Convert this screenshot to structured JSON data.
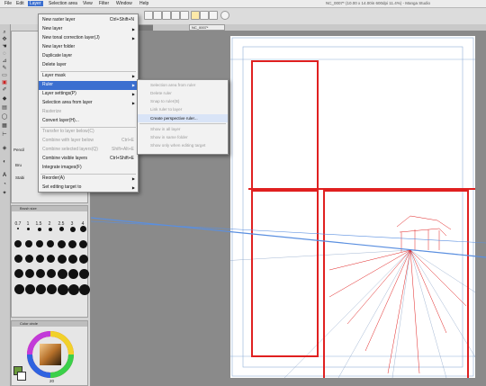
{
  "menubar": {
    "items": [
      "File",
      "Edit",
      "Layer",
      "Selection area",
      "View",
      "Filter",
      "Window",
      "Help"
    ],
    "active": "Layer"
  },
  "window": {
    "title": "NC_0007* (10.00 x 14.00in 600dpi 11.4%) - Manga Studio"
  },
  "tab": {
    "label": "NC_0007*"
  },
  "layer_menu": {
    "items": [
      {
        "label": "New raster layer",
        "shortcut": "Ctrl+Shift+N",
        "enabled": true,
        "arrow": false
      },
      {
        "label": "New layer",
        "shortcut": "",
        "enabled": true,
        "arrow": true
      },
      {
        "label": "New tonal correction layer(J)",
        "shortcut": "",
        "enabled": true,
        "arrow": true
      },
      {
        "label": "New layer folder",
        "shortcut": "",
        "enabled": true,
        "arrow": false
      },
      {
        "label": "Duplicate layer",
        "shortcut": "",
        "enabled": true,
        "arrow": false
      },
      {
        "label": "Delete layer",
        "shortcut": "",
        "enabled": true,
        "arrow": false
      },
      {
        "label": "Layer mask",
        "shortcut": "",
        "enabled": true,
        "arrow": true
      },
      {
        "label": "Ruler",
        "shortcut": "",
        "enabled": true,
        "arrow": true,
        "highlight": true
      },
      {
        "label": "Layer settings(P)",
        "shortcut": "",
        "enabled": true,
        "arrow": true
      },
      {
        "label": "Selection area from layer",
        "shortcut": "",
        "enabled": true,
        "arrow": true
      },
      {
        "label": "Rasterize",
        "shortcut": "",
        "enabled": false,
        "arrow": false
      },
      {
        "label": "Convert layer(H)...",
        "shortcut": "",
        "enabled": true,
        "arrow": false
      },
      {
        "label": "Transfer to layer below(C)",
        "shortcut": "",
        "enabled": false,
        "arrow": false
      },
      {
        "label": "Combine with layer below",
        "shortcut": "Ctrl+E",
        "enabled": false,
        "arrow": false
      },
      {
        "label": "Combine selected layers(Q)",
        "shortcut": "Shift+Alt+E",
        "enabled": false,
        "arrow": false
      },
      {
        "label": "Combine visible layers",
        "shortcut": "Ctrl+Shift+E",
        "enabled": true,
        "arrow": false
      },
      {
        "label": "Integrate images(F)",
        "shortcut": "",
        "enabled": true,
        "arrow": false
      },
      {
        "label": "Reorder(A)",
        "shortcut": "",
        "enabled": true,
        "arrow": true
      },
      {
        "label": "Set editing target to",
        "shortcut": "",
        "enabled": true,
        "arrow": true
      }
    ]
  },
  "ruler_submenu": {
    "items": [
      {
        "label": "Selection area from ruler",
        "enabled": false
      },
      {
        "label": "Delete ruler",
        "enabled": false
      },
      {
        "label": "Snap to ruler(B)",
        "enabled": false
      },
      {
        "label": "Link ruler to layer",
        "enabled": false
      },
      {
        "label": "Create perspective ruler...",
        "enabled": true,
        "highlight": true
      },
      {
        "label": "Show in all layer",
        "enabled": false
      },
      {
        "label": "Show in same folder",
        "enabled": false
      },
      {
        "label": "Show only when editing target",
        "enabled": false
      }
    ]
  },
  "left_panel": {
    "tool_tabs": [
      "Pencil",
      "Bru",
      "Stabi"
    ],
    "brush_size_title": "Brush size",
    "brush_sizes": [
      "0.7",
      "1",
      "1.5",
      "2",
      "2.5",
      "3",
      "4"
    ],
    "color_circle_title": "Color circle",
    "color_value": "20"
  },
  "colors": {
    "accent": "#3b6fd0",
    "ink_red": "#e02020",
    "perspective_blue": "#5a8fe0",
    "selected_color": "#6a9a3c"
  },
  "icons": [
    "pen-icon",
    "eraser-icon",
    "fill-icon",
    "text-icon",
    "move-icon",
    "zoom-icon",
    "hand-icon",
    "lasso-icon",
    "eyedropper-icon",
    "ruler-icon"
  ]
}
